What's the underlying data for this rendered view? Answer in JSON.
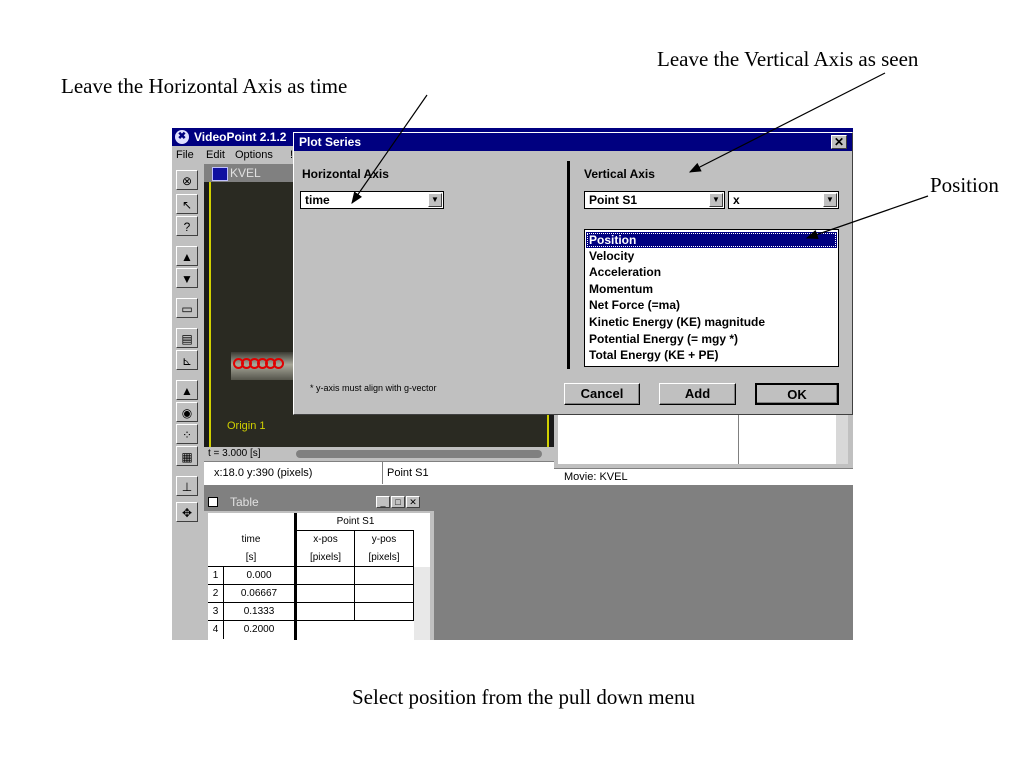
{
  "annotations": {
    "horizontal": "Leave the Horizontal Axis as time",
    "vertical": "Leave the Vertical Axis as seen",
    "position": "Position",
    "select": "Select position from the pull down menu"
  },
  "app": {
    "title": "VideoPoint 2.1.2",
    "menu": [
      "File",
      "Edit",
      "Options",
      "!"
    ]
  },
  "movie": {
    "title": "KVEL",
    "origin_label": "Origin 1",
    "time": "t = 3.000 [s]",
    "coords": "x:18.0  y:390 (pixels)",
    "point": "Point S1"
  },
  "graph": {
    "status": "Movie: KVEL"
  },
  "table": {
    "title": "Table",
    "group_header": "Point S1",
    "headers": {
      "time": "time",
      "time_unit": "[s]",
      "xpos": "x-pos",
      "xpos_unit": "[pixels]",
      "ypos": "y-pos",
      "ypos_unit": "[pixels]"
    },
    "rows": [
      {
        "n": "1",
        "t": "0.000"
      },
      {
        "n": "2",
        "t": "0.06667"
      },
      {
        "n": "3",
        "t": "0.1333"
      },
      {
        "n": "4",
        "t": "0.2000"
      }
    ]
  },
  "dialog": {
    "title": "Plot Series",
    "close": "✕",
    "horizontal_label": "Horizontal Axis",
    "horizontal_value": "time",
    "vertical_label": "Vertical Axis",
    "vertical_point": "Point S1",
    "vertical_component": "x",
    "quantities": [
      "Position",
      "Velocity",
      "Acceleration",
      "Momentum",
      "Net Force (=ma)",
      "Kinetic Energy (KE) magnitude",
      "Potential Energy (= mgy *)",
      "Total Energy (KE + PE)"
    ],
    "footnote": "* y-axis must align with g-vector",
    "cancel": "Cancel",
    "add": "Add",
    "ok": "OK"
  },
  "colors": {
    "titlebar": "#000080",
    "window": "#c0c0c0",
    "selection": "#000080",
    "track_mark": "#e00000"
  }
}
